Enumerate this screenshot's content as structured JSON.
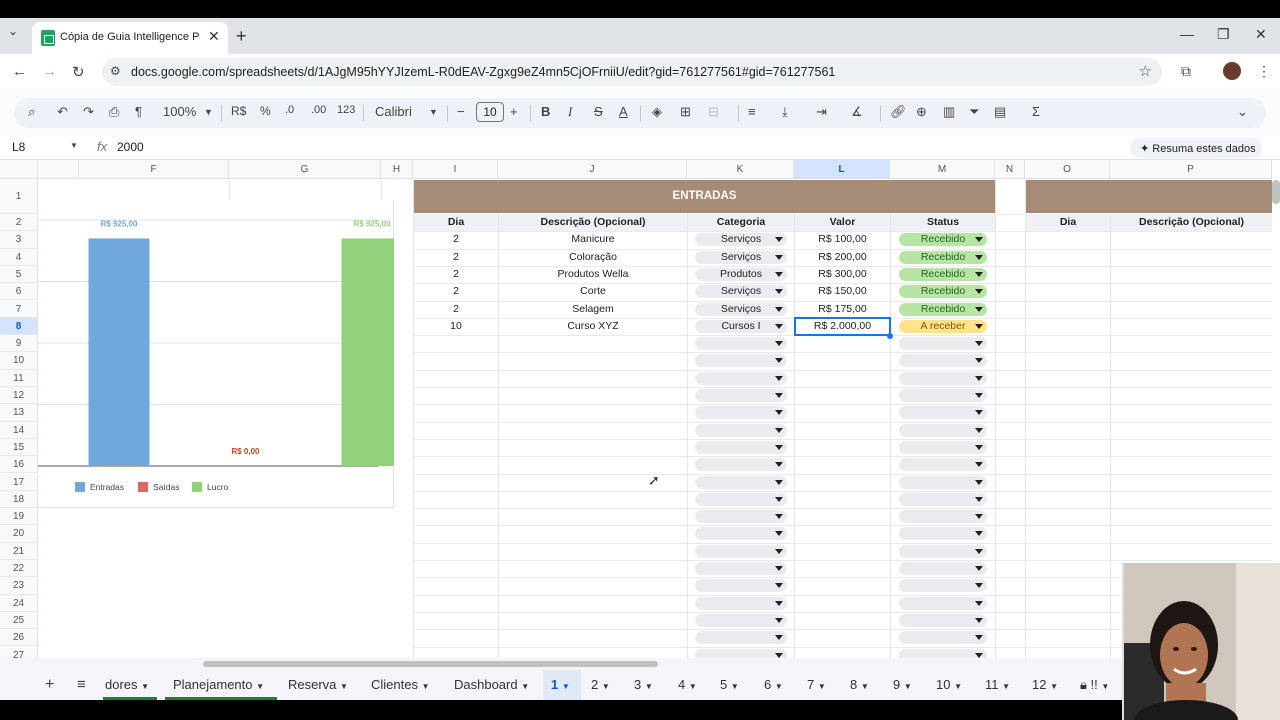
{
  "browser": {
    "tab_title": "Cópia de Guia Intelligence PJ - ...",
    "url": "docs.google.com/spreadsheets/d/1AJgM95hYYJIzemL-R0dEAV-Zgxg9eZ4mn5CjOFrniiU/edit?gid=761277561#gid=761277561"
  },
  "toolbar": {
    "zoom": "100%",
    "currency": "R$",
    "percent": "%",
    "dec_less": ".0",
    "dec_more": ".00",
    "number_format": "123",
    "font": "Calibri",
    "font_size": "10",
    "bold": "B",
    "italic": "I",
    "strike": "S",
    "text_color": "A"
  },
  "formula_bar": {
    "cell_ref": "L8",
    "fx": "fx",
    "value": "2000",
    "summarize": "Resuma estes dados"
  },
  "columns": [
    {
      "label": "F",
      "sel": false
    },
    {
      "label": "G",
      "sel": false
    },
    {
      "label": "H",
      "sel": false
    },
    {
      "label": "I",
      "sel": false
    },
    {
      "label": "J",
      "sel": false
    },
    {
      "label": "K",
      "sel": false
    },
    {
      "label": "L",
      "sel": true
    },
    {
      "label": "M",
      "sel": false
    },
    {
      "label": "N",
      "sel": false
    },
    {
      "label": "O",
      "sel": false
    },
    {
      "label": "P",
      "sel": false
    }
  ],
  "rows": [
    "1",
    "2",
    "3",
    "4",
    "5",
    "6",
    "7",
    "8",
    "9",
    "10",
    "11",
    "12",
    "13",
    "14",
    "15",
    "16",
    "17",
    "18",
    "19",
    "20",
    "21",
    "22",
    "23",
    "24",
    "25",
    "26",
    "27"
  ],
  "selected_row": "8",
  "entradas": {
    "title": "ENTRADAS",
    "headers": [
      "Dia",
      "Descrição (Opcional)",
      "Categoria",
      "Valor",
      "Status"
    ],
    "rows": [
      {
        "dia": "2",
        "desc": "Manicure",
        "cat": "Serviços",
        "valor": "R$ 100,00",
        "status": "Recebido"
      },
      {
        "dia": "2",
        "desc": "Coloração",
        "cat": "Serviços",
        "valor": "R$ 200,00",
        "status": "Recebido"
      },
      {
        "dia": "2",
        "desc": "Produtos Wella",
        "cat": "Produtos",
        "valor": "R$ 300,00",
        "status": "Recebido"
      },
      {
        "dia": "2",
        "desc": "Corte",
        "cat": "Serviços",
        "valor": "R$ 150,00",
        "status": "Recebido"
      },
      {
        "dia": "2",
        "desc": "Selagem",
        "cat": "Serviços",
        "valor": "R$ 175,00",
        "status": "Recebido"
      },
      {
        "dia": "10",
        "desc": "Curso XYZ",
        "cat": "Cursos I",
        "valor": "R$ 2.000,00",
        "status": "A receber"
      }
    ],
    "empty_rows": 19
  },
  "right_table": {
    "headers": [
      "Dia",
      "Descrição (Opcional)"
    ]
  },
  "chart_data": {
    "type": "bar",
    "categories": [
      "Entradas",
      "Saídas",
      "Lucro"
    ],
    "values": [
      925,
      0,
      925
    ],
    "data_labels": [
      "R$ 925,00",
      "R$ 0,00",
      "R$ 925,00"
    ],
    "colors": [
      "#6fa8dc",
      "#e06666",
      "#93d07a"
    ],
    "label_colors": [
      "#6fa8dc",
      "#cc4125",
      "#93d07a"
    ],
    "legend": [
      "Entradas",
      "Saídas",
      "Lucro"
    ],
    "legend_position": "bottom",
    "ylim": [
      0,
      1000
    ],
    "grid": true,
    "title": "",
    "xlabel": "",
    "ylabel": ""
  },
  "sheet_tabs": [
    {
      "label": "dores",
      "active": false
    },
    {
      "label": "Planejamento",
      "active": false
    },
    {
      "label": "Reserva",
      "active": false
    },
    {
      "label": "Clientes",
      "active": false
    },
    {
      "label": "Dashboard",
      "active": false
    },
    {
      "label": "1",
      "active": true
    },
    {
      "label": "2",
      "active": false
    },
    {
      "label": "3",
      "active": false
    },
    {
      "label": "4",
      "active": false
    },
    {
      "label": "5",
      "active": false
    },
    {
      "label": "6",
      "active": false
    },
    {
      "label": "7",
      "active": false
    },
    {
      "label": "8",
      "active": false
    },
    {
      "label": "9",
      "active": false
    },
    {
      "label": "10",
      "active": false
    },
    {
      "label": "11",
      "active": false
    },
    {
      "label": "12",
      "active": false
    },
    {
      "label": "!!",
      "active": false
    }
  ],
  "colors": {
    "banner": "#a68b77",
    "received": "#b7e4a4",
    "pending": "#ffe38a",
    "selection": "#1a73e8"
  }
}
